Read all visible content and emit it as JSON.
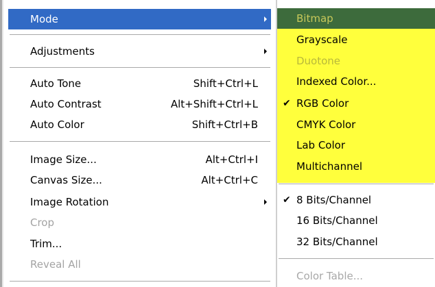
{
  "main_menu": {
    "items": [
      {
        "label": "Mode",
        "shortcut": "",
        "submenu": true,
        "highlighted": true,
        "disabled": false
      },
      {
        "label": "Adjustments",
        "shortcut": "",
        "submenu": true,
        "disabled": false
      },
      {
        "label": "Auto Tone",
        "shortcut": "Shift+Ctrl+L",
        "disabled": false
      },
      {
        "label": "Auto Contrast",
        "shortcut": "Alt+Shift+Ctrl+L",
        "disabled": false
      },
      {
        "label": "Auto Color",
        "shortcut": "Shift+Ctrl+B",
        "disabled": false
      },
      {
        "label": "Image Size...",
        "shortcut": "Alt+Ctrl+I",
        "disabled": false
      },
      {
        "label": "Canvas Size...",
        "shortcut": "Alt+Ctrl+C",
        "disabled": false
      },
      {
        "label": "Image Rotation",
        "shortcut": "",
        "submenu": true,
        "disabled": false
      },
      {
        "label": "Crop",
        "shortcut": "",
        "disabled": true
      },
      {
        "label": "Trim...",
        "shortcut": "",
        "disabled": false
      },
      {
        "label": "Reveal All",
        "shortcut": "",
        "disabled": true
      }
    ]
  },
  "mode_submenu": {
    "items": [
      {
        "label": "Bitmap",
        "checked": false,
        "highlighted": true,
        "disabled": true
      },
      {
        "label": "Grayscale",
        "checked": false,
        "disabled": false
      },
      {
        "label": "Duotone",
        "checked": false,
        "disabled": true
      },
      {
        "label": "Indexed Color...",
        "checked": false,
        "disabled": false
      },
      {
        "label": "RGB Color",
        "checked": true,
        "disabled": false
      },
      {
        "label": "CMYK Color",
        "checked": false,
        "disabled": false
      },
      {
        "label": "Lab Color",
        "checked": false,
        "disabled": false
      },
      {
        "label": "Multichannel",
        "checked": false,
        "disabled": false
      },
      {
        "label": "8 Bits/Channel",
        "checked": true,
        "disabled": false
      },
      {
        "label": "16 Bits/Channel",
        "checked": false,
        "disabled": false
      },
      {
        "label": "32 Bits/Channel",
        "checked": false,
        "disabled": false
      },
      {
        "label": "Color Table...",
        "checked": false,
        "disabled": true
      }
    ],
    "check_glyph": "✔"
  },
  "colors": {
    "menu_highlight": "#316ac5",
    "submenu_highlight": "#3d6b3c",
    "submenu_mark_yellow": "#ffff3c",
    "disabled_text": "#a3a3a3"
  }
}
